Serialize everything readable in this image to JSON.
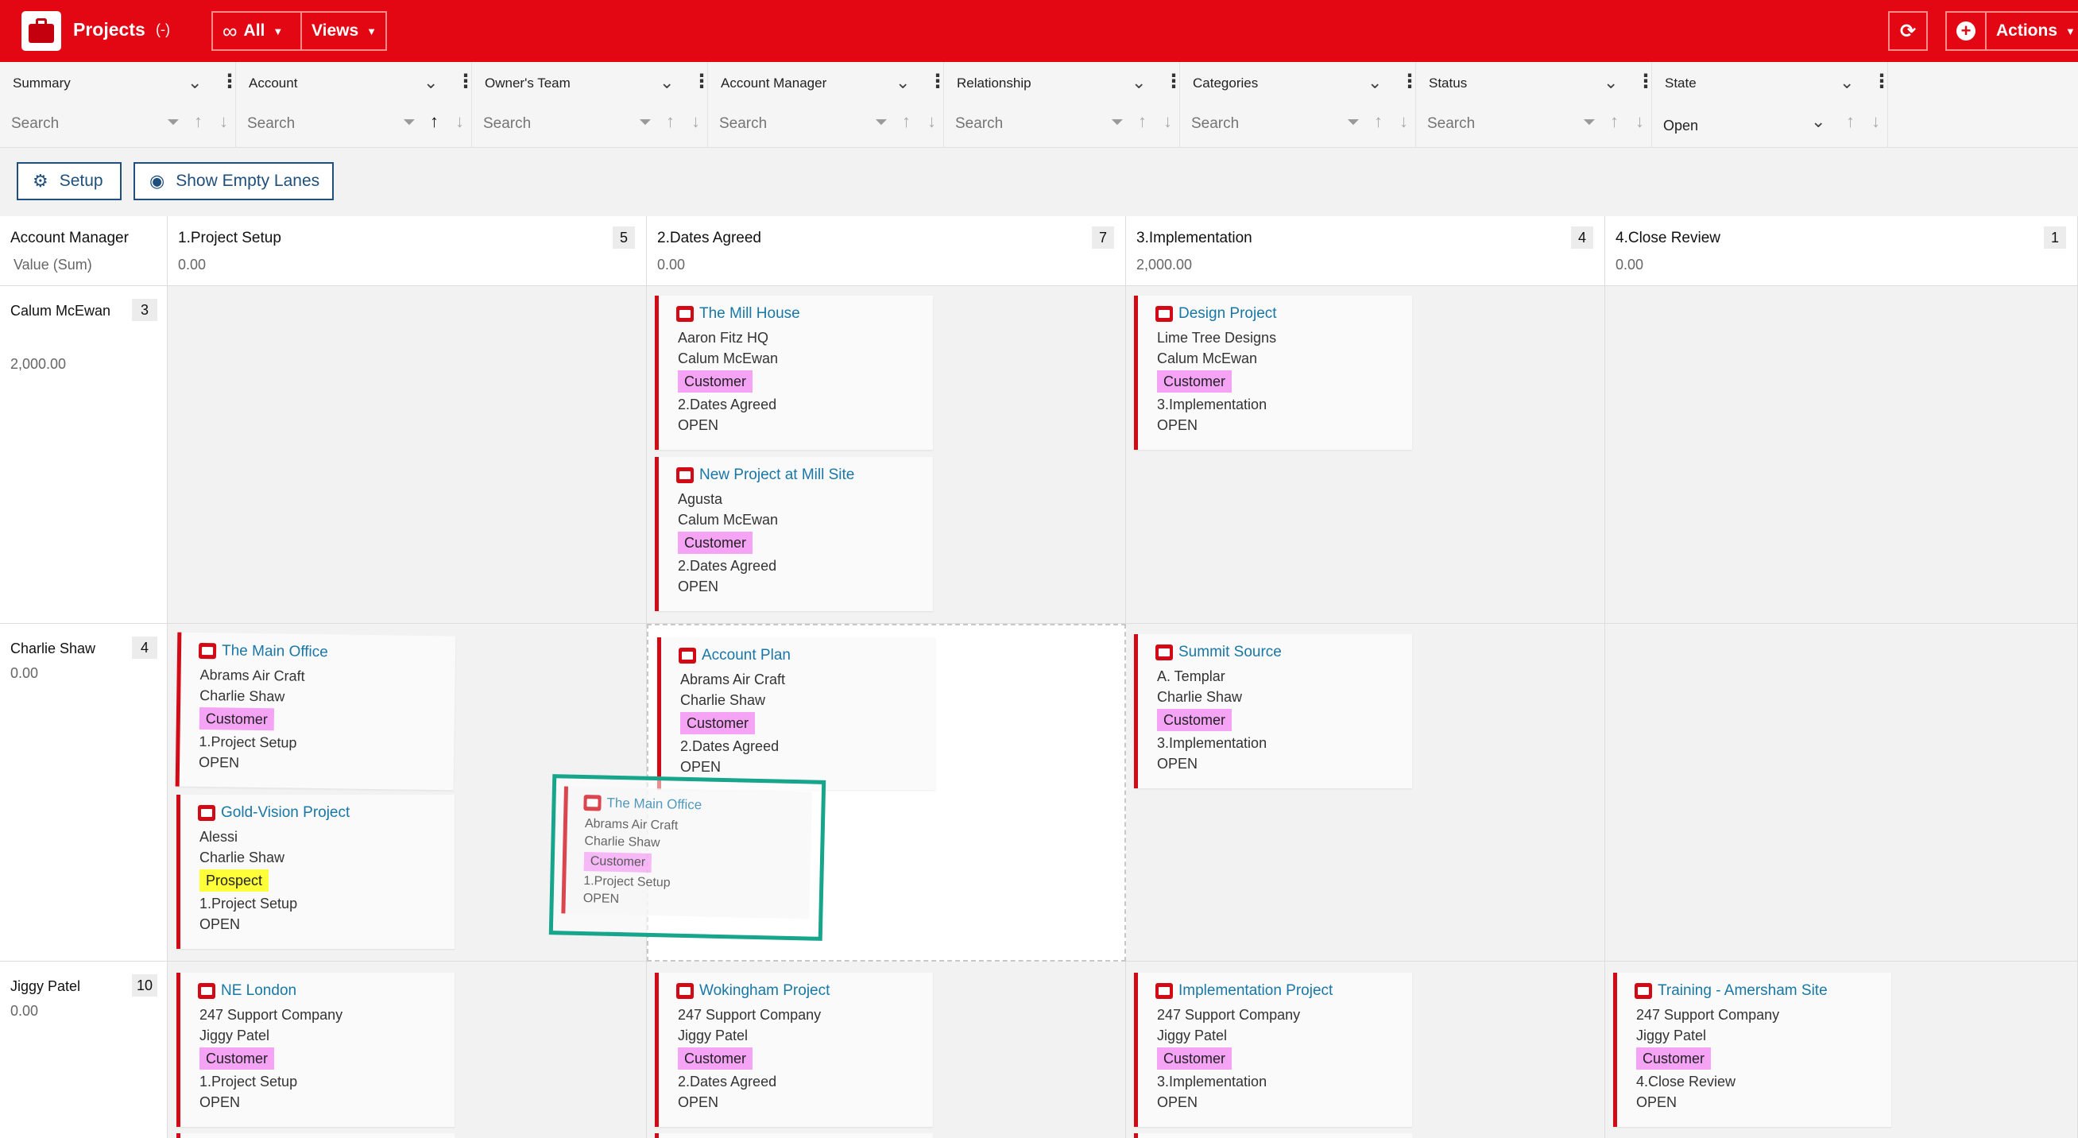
{
  "app": {
    "title": "Projects",
    "count": "(-)"
  },
  "toolbar": {
    "all_label": "All",
    "views_label": "Views",
    "actions_label": "Actions"
  },
  "filters": [
    {
      "name": "Summary",
      "placeholder": "Search"
    },
    {
      "name": "Account",
      "placeholder": "Search"
    },
    {
      "name": "Owner's Team",
      "placeholder": "Search"
    },
    {
      "name": "Account Manager",
      "placeholder": "Search"
    },
    {
      "name": "Relationship",
      "placeholder": "Search"
    },
    {
      "name": "Categories",
      "placeholder": "Search"
    },
    {
      "name": "Status",
      "placeholder": "Search"
    },
    {
      "name": "State",
      "value": "Open"
    }
  ],
  "buttons": {
    "setup": "Setup",
    "show_empty": "Show Empty Lanes"
  },
  "board": {
    "row_header": {
      "title": "Account Manager",
      "sub": "Value (Sum)"
    },
    "columns": [
      {
        "name": "1.Project Setup",
        "count": "5",
        "value": "0.00"
      },
      {
        "name": "2.Dates Agreed",
        "count": "7",
        "value": "0.00"
      },
      {
        "name": "3.Implementation",
        "count": "4",
        "value": "2,000.00"
      },
      {
        "name": "4.Close Review",
        "count": "1",
        "value": "0.00"
      }
    ],
    "lanes": [
      {
        "name": "Calum McEwan",
        "count": "3",
        "value": "2,000.00"
      },
      {
        "name": "Charlie Shaw",
        "count": "4",
        "value": "0.00"
      },
      {
        "name": "Jiggy Patel",
        "count": "10",
        "value": "0.00"
      }
    ]
  },
  "cards": {
    "c1": {
      "title": "The Mill House",
      "account": "Aaron Fitz HQ",
      "manager": "Calum McEwan",
      "tag": "Customer",
      "stage": "2.Dates Agreed",
      "state": "OPEN"
    },
    "c2": {
      "title": "New Project at Mill Site",
      "account": "Agusta",
      "manager": "Calum McEwan",
      "tag": "Customer",
      "stage": "2.Dates Agreed",
      "state": "OPEN"
    },
    "c3": {
      "title": "Design Project",
      "account": "Lime Tree Designs",
      "manager": "Calum McEwan",
      "tag": "Customer",
      "stage": "3.Implementation",
      "state": "OPEN"
    },
    "c4": {
      "title": "The Main Office",
      "account": "Abrams Air Craft",
      "manager": "Charlie Shaw",
      "tag": "Customer",
      "stage": "1.Project Setup",
      "state": "OPEN"
    },
    "c5": {
      "title": "Gold-Vision Project",
      "account": "Alessi",
      "manager": "Charlie Shaw",
      "tag": "Prospect",
      "stage": "1.Project Setup",
      "state": "OPEN"
    },
    "c6": {
      "title": "Account Plan",
      "account": "Abrams Air Craft",
      "manager": "Charlie Shaw",
      "tag": "Customer",
      "stage": "2.Dates Agreed",
      "state": "OPEN"
    },
    "c7": {
      "title": "Summit Source",
      "account": "A. Templar",
      "manager": "Charlie Shaw",
      "tag": "Customer",
      "stage": "3.Implementation",
      "state": "OPEN"
    },
    "c8": {
      "title": "NE London",
      "account": "247 Support Company",
      "manager": "Jiggy Patel",
      "tag": "Customer",
      "stage": "1.Project Setup",
      "state": "OPEN"
    },
    "c9": {
      "title": "Wokingham Project",
      "account": "247 Support Company",
      "manager": "Jiggy Patel",
      "tag": "Customer",
      "stage": "2.Dates Agreed",
      "state": "OPEN"
    },
    "c10": {
      "title": "Implementation Project",
      "account": "247 Support Company",
      "manager": "Jiggy Patel",
      "tag": "Customer",
      "stage": "3.Implementation",
      "state": "OPEN"
    },
    "c11": {
      "title": "Training - Amersham Site",
      "account": "247 Support Company",
      "manager": "Jiggy Patel",
      "tag": "Customer",
      "stage": "4.Close Review",
      "state": "OPEN"
    },
    "drag": {
      "title": "The Main Office",
      "account": "Abrams Air Craft",
      "manager": "Charlie Shaw",
      "tag": "Customer",
      "stage": "1.Project Setup",
      "state": "OPEN"
    }
  },
  "colors": {
    "brand": "#e30613",
    "card_accent": "#d10a16",
    "link": "#1877a6",
    "customer_tag": "#f5a3f5",
    "prospect_tag": "#ffff3a",
    "drag_outline": "#17a58c"
  }
}
